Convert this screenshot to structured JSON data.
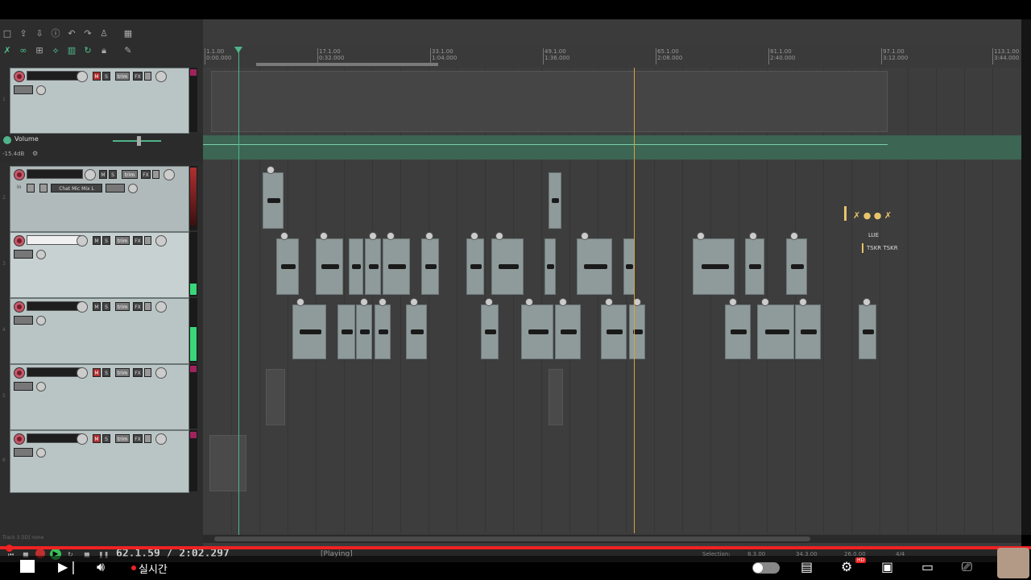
{
  "toolbar": {
    "volume_label": "Volume",
    "volume_db": "-15.4dB"
  },
  "tracks": [
    {
      "num": "1",
      "name": ""
    },
    {
      "num": "2",
      "name": "",
      "input": "in",
      "input_name": "Chat Mic Mix L"
    },
    {
      "num": "3",
      "name": ""
    },
    {
      "num": "4",
      "name": ""
    },
    {
      "num": "5",
      "name": ""
    },
    {
      "num": "6",
      "name": ""
    }
  ],
  "buttons": {
    "mute": "M",
    "solo": "S",
    "fx": "FX",
    "trim": "trim"
  },
  "ruler": [
    {
      "bar": "1.1.00",
      "time": "0:00.000"
    },
    {
      "bar": "17.1.00",
      "time": "0:32.000"
    },
    {
      "bar": "33.1.00",
      "time": "1:04.000"
    },
    {
      "bar": "49.1.00",
      "time": "1:36.000"
    },
    {
      "bar": "65.1.00",
      "time": "2:08.000"
    },
    {
      "bar": "81.1.00",
      "time": "2:40.000"
    },
    {
      "bar": "97.1.00",
      "time": "3:12.000"
    },
    {
      "bar": "113.1.00",
      "time": "3:44.000"
    }
  ],
  "transport": {
    "position": "62.1.59 / 2:02.297",
    "state": "[Playing]",
    "selection_label": "Selection:",
    "sel_start": "8.3.00",
    "sel_end": "34.3.00",
    "sel_len": "26.0.00",
    "timesig": "4/4"
  },
  "status": {
    "left": "Track 3 [ID] none"
  },
  "overlay": {
    "line1": "LUE",
    "line2": "TSKR TSKR"
  },
  "youtube": {
    "live": "실시간",
    "hd": "HD"
  },
  "colors": {
    "accent_green": "#4fb48a",
    "play_cursor": "#d8a33a",
    "record": "#c45a6a",
    "yt_red": "#e22222"
  }
}
